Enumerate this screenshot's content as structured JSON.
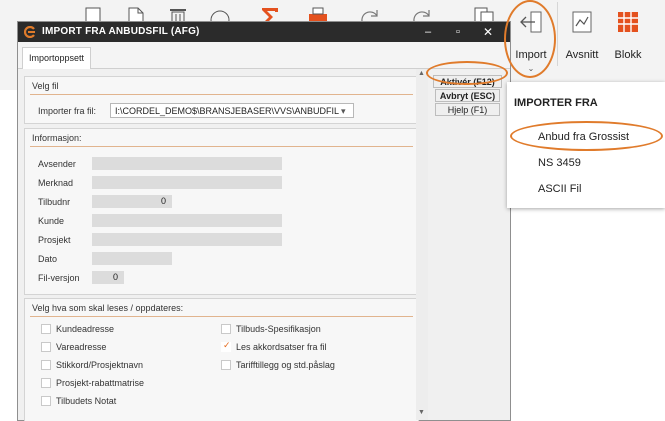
{
  "ribbon": {
    "import_label": "Import",
    "avsnitt_label": "Avsnitt",
    "blokk_label": "Blokk",
    "chevron": "⌄"
  },
  "dialog": {
    "title": "IMPORT FRA ANBUDSFIL (AFG)",
    "tab": "Importoppsett",
    "velg_fil": {
      "title": "Velg fil",
      "importer_label": "Importer fra fil:",
      "path_value": "I:\\CORDEL_DEMO$\\BRANSJEBASER\\VVS\\ANBUDFIL"
    },
    "informasjon": {
      "title": "Informasjon:",
      "fields": [
        {
          "label": "Avsender",
          "value": ""
        },
        {
          "label": "Merknad",
          "value": ""
        },
        {
          "label": "Tilbudnr",
          "value": "0"
        },
        {
          "label": "Kunde",
          "value": ""
        },
        {
          "label": "Prosjekt",
          "value": ""
        },
        {
          "label": "Dato",
          "value": ""
        },
        {
          "label": "Fil-versjon",
          "value": "0"
        }
      ]
    },
    "velg_hva": {
      "title": "Velg hva som skal leses / oppdateres:",
      "left": [
        {
          "label": "Kundeadresse",
          "checked": false
        },
        {
          "label": "Vareadresse",
          "checked": false
        },
        {
          "label": "Stikkord/Prosjektnavn",
          "checked": false
        },
        {
          "label": "Prosjekt-rabattmatrise",
          "checked": false
        },
        {
          "label": "Tilbudets Notat",
          "checked": false
        }
      ],
      "right": [
        {
          "label": "Tilbuds-Spesifikasjon",
          "checked": false
        },
        {
          "label": "Les akkordsatser fra fil",
          "checked": true
        },
        {
          "label": "Tarifftillegg og std.påslag",
          "checked": false
        }
      ]
    },
    "buttons": {
      "aktiver": "Aktivér (F12)",
      "avbryt": "Avbryt (ESC)",
      "hjelp": "Hjelp (F1)"
    }
  },
  "menu": {
    "header": "IMPORTER FRA",
    "items": [
      "Anbud fra Grossist",
      "NS 3459",
      "ASCII Fil"
    ]
  },
  "colors": {
    "accent": "#e07b2b",
    "titlebar": "#2b2b2b"
  }
}
